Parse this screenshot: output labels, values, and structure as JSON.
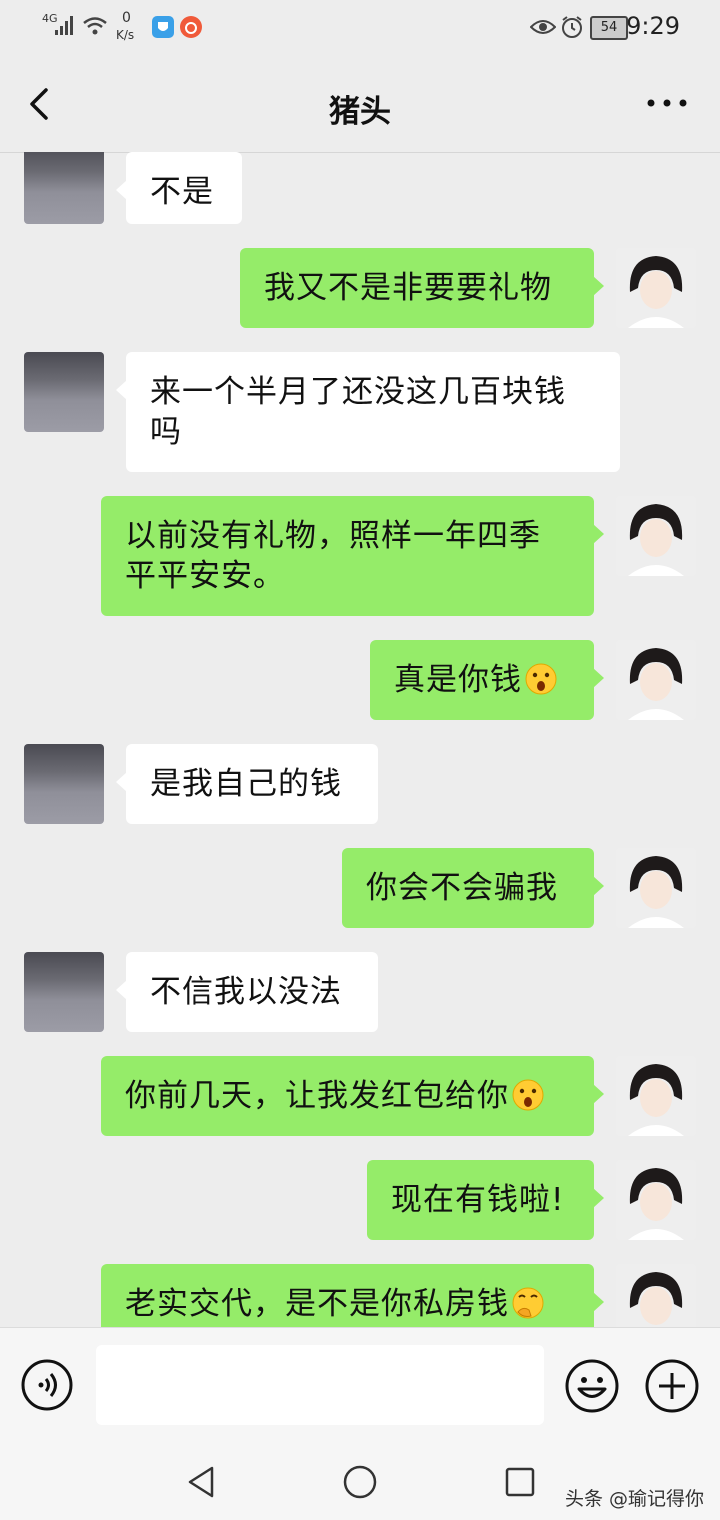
{
  "status_bar": {
    "network": "4G",
    "speed_value": "0",
    "speed_unit": "K/s",
    "battery": "54",
    "time": "9:29"
  },
  "header": {
    "title": "猪头"
  },
  "messages": [
    {
      "side": "left",
      "text": "不是"
    },
    {
      "side": "right",
      "text": "我又不是非要要礼物"
    },
    {
      "side": "left",
      "text": "来一个半月了还没这几百块钱吗"
    },
    {
      "side": "right",
      "text": "以前没有礼物，照样一年四季平平安安。"
    },
    {
      "side": "right",
      "text": "真是你钱",
      "emoji": "surprised-emoji"
    },
    {
      "side": "left",
      "text": "是我自己的钱"
    },
    {
      "side": "right",
      "text": "你会不会骗我"
    },
    {
      "side": "left",
      "text": "不信我以没法"
    },
    {
      "side": "right",
      "text": "你前几天，让我发红包给你",
      "emoji": "surprised-emoji"
    },
    {
      "side": "right",
      "text": "现在有钱啦!"
    },
    {
      "side": "right",
      "text": "老实交代，是不是你私房钱",
      "emoji": "thinking-emoji"
    }
  ],
  "input_bar": {
    "placeholder": "",
    "value": ""
  },
  "watermark": "头条 @瑜记得你",
  "colors": {
    "background": "#ededed",
    "bubble_green": "#95ec69",
    "bubble_white": "#ffffff"
  }
}
